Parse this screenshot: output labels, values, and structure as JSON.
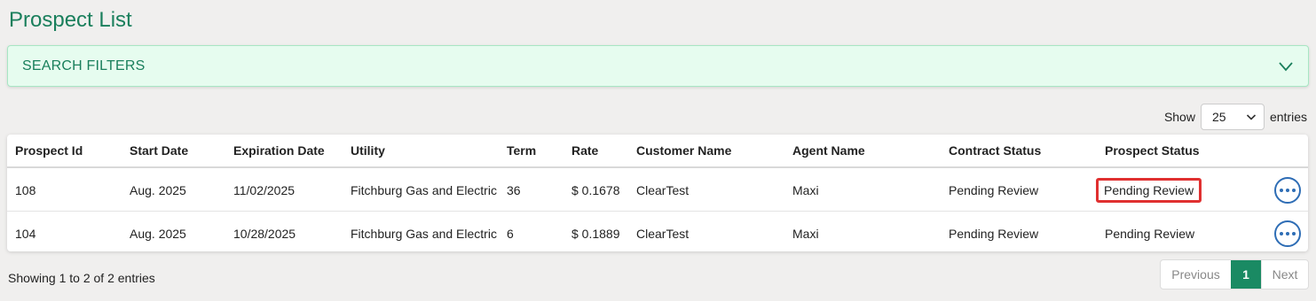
{
  "page": {
    "title": "Prospect List"
  },
  "filters": {
    "label": "SEARCH FILTERS",
    "icon": "chevron-down-icon"
  },
  "length": {
    "show_label": "Show",
    "value": "25",
    "entries_label": "entries"
  },
  "table": {
    "headers": [
      "Prospect Id",
      "Start Date",
      "Expiration Date",
      "Utility",
      "Term",
      "Rate",
      "Customer Name",
      "Agent Name",
      "Contract Status",
      "Prospect Status"
    ],
    "rows": [
      {
        "prospect_id": "108",
        "start_date": "Aug. 2025",
        "expiration_date": "11/02/2025",
        "utility": "Fitchburg Gas and Electric",
        "term": "36",
        "rate": "$ 0.1678",
        "customer_name": "ClearTest",
        "agent_name": "Maxi",
        "contract_status": "Pending Review",
        "prospect_status": "Pending Review",
        "highlighted": true
      },
      {
        "prospect_id": "104",
        "start_date": "Aug. 2025",
        "expiration_date": "10/28/2025",
        "utility": "Fitchburg Gas and Electric",
        "term": "6",
        "rate": "$ 0.1889",
        "customer_name": "ClearTest",
        "agent_name": "Maxi",
        "contract_status": "Pending Review",
        "prospect_status": "Pending Review",
        "highlighted": false
      }
    ]
  },
  "footer": {
    "info": "Showing 1 to 2 of 2 entries",
    "pagination": {
      "previous": "Previous",
      "current": "1",
      "next": "Next"
    }
  },
  "colors": {
    "accent": "#1a7f5c",
    "active_page": "#1a8a63",
    "highlight_border": "#e03030",
    "action_button": "#2e6db5"
  }
}
